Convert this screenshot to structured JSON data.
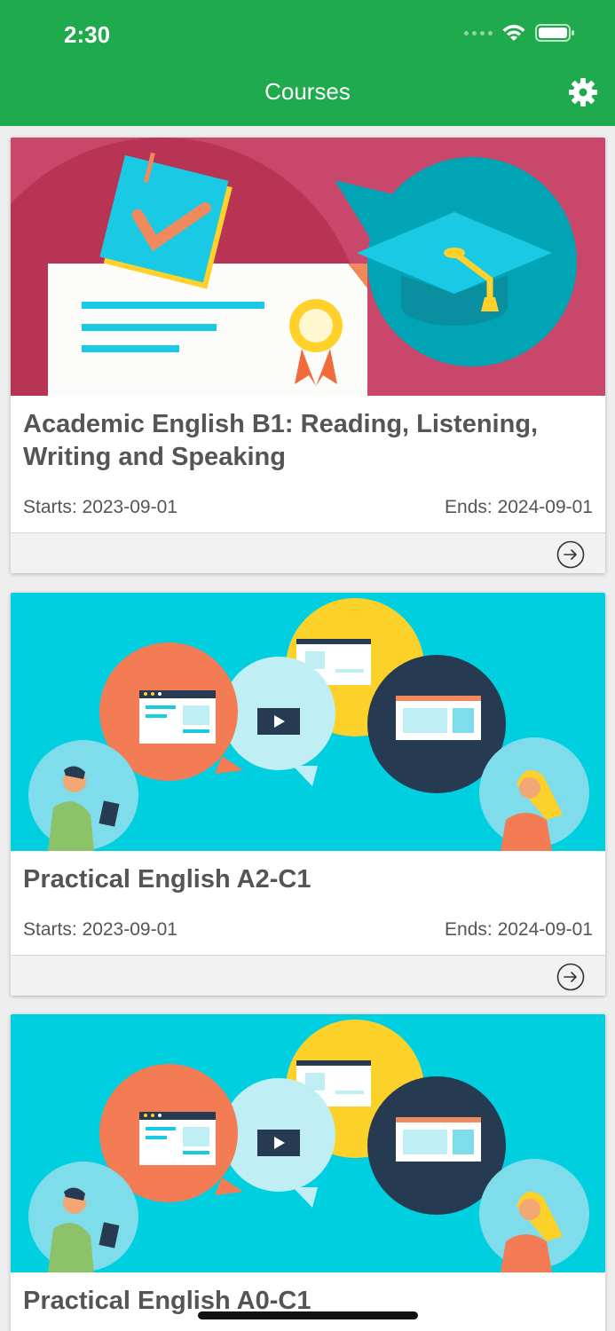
{
  "status_bar": {
    "time": "2:30",
    "icons": [
      "signal-dots-icon",
      "wifi-icon",
      "battery-icon"
    ]
  },
  "header": {
    "title": "Courses",
    "settings_icon": "gear-icon"
  },
  "courses": [
    {
      "title": "Academic English B1: Reading, Listening, Writing and Speaking",
      "starts": "Starts: 2023-09-01",
      "ends": "Ends: 2024-09-01"
    },
    {
      "title": "Practical English A2-C1",
      "starts": "Starts: 2023-09-01",
      "ends": "Ends: 2024-09-01"
    },
    {
      "title": "Practical English A0-C1"
    }
  ],
  "colors": {
    "header_bg": "#1faa4d",
    "card_text": "#555555",
    "footer_bg": "#f2f2f2"
  }
}
